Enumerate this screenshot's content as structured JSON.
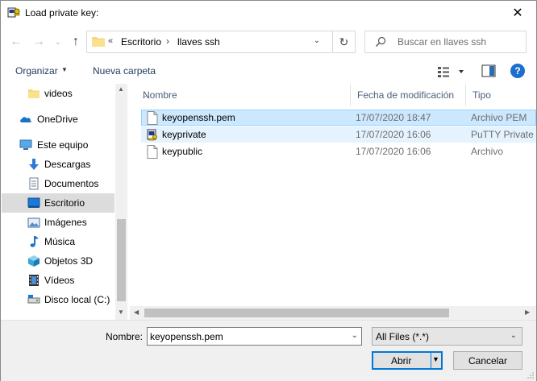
{
  "window": {
    "title": "Load private key:"
  },
  "address": {
    "overflow": "«",
    "crumbs": [
      "Escritorio",
      "llaves ssh"
    ]
  },
  "search": {
    "placeholder": "Buscar en llaves ssh"
  },
  "toolbar": {
    "organize": "Organizar",
    "new_folder": "Nueva carpeta"
  },
  "sidebar": {
    "items": [
      {
        "label": "videos",
        "icon": "folder-icon"
      },
      {
        "label": "OneDrive",
        "icon": "cloud-icon"
      },
      {
        "label": "Este equipo",
        "icon": "computer-icon"
      },
      {
        "label": "Descargas",
        "icon": "download-icon"
      },
      {
        "label": "Documentos",
        "icon": "document-icon"
      },
      {
        "label": "Escritorio",
        "icon": "desktop-icon",
        "selected": true
      },
      {
        "label": "Imágenes",
        "icon": "pictures-icon"
      },
      {
        "label": "Música",
        "icon": "music-icon"
      },
      {
        "label": "Objetos 3D",
        "icon": "cube-icon"
      },
      {
        "label": "Vídeos",
        "icon": "film-icon"
      },
      {
        "label": "Disco local (C:)",
        "icon": "drive-icon"
      }
    ]
  },
  "columns": {
    "name": "Nombre",
    "modified": "Fecha de modificación",
    "type": "Tipo"
  },
  "files": [
    {
      "name": "keyopenssh.pem",
      "modified": "17/07/2020 18:47",
      "type": "Archivo PEM",
      "icon": "file-icon"
    },
    {
      "name": "keyprivate",
      "modified": "17/07/2020 16:06",
      "type": "PuTTY Private Key File",
      "icon": "putty-key-icon"
    },
    {
      "name": "keypublic",
      "modified": "17/07/2020 16:06",
      "type": "Archivo",
      "icon": "file-icon"
    }
  ],
  "footer": {
    "name_label": "Nombre:",
    "name_value": "keyopenssh.pem",
    "filter": "All Files (*.*)",
    "open": "Abrir",
    "cancel": "Cancelar"
  },
  "colors": {
    "selection": "#cce8ff",
    "accent": "#0078d7",
    "link": "#1e395b"
  }
}
